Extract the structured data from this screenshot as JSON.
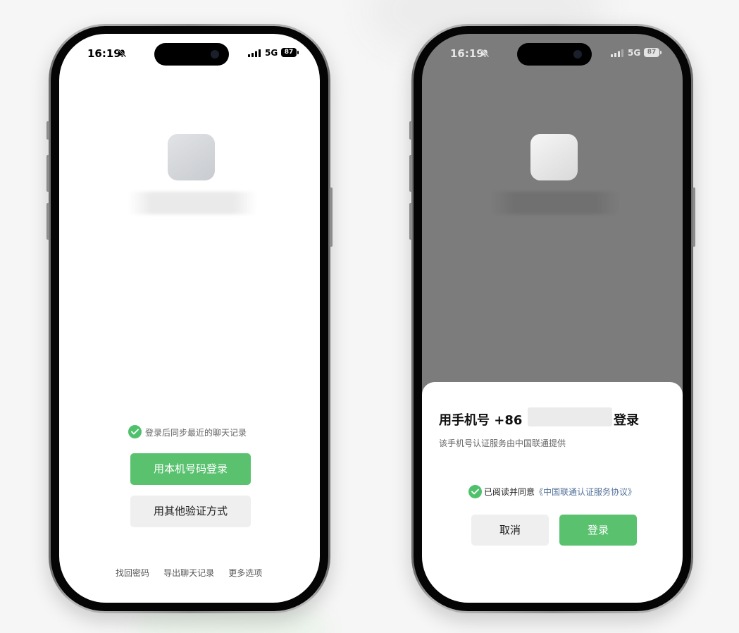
{
  "left_phone": {
    "status": {
      "time": "16:19",
      "network": "5G",
      "battery": "87"
    },
    "sync_label": "登录后同步最近的聊天记录",
    "primary_button": "用本机号码登录",
    "secondary_button": "用其他验证方式",
    "links": [
      "找回密码",
      "导出聊天记录",
      "更多选项"
    ]
  },
  "right_phone": {
    "status": {
      "time": "16:19",
      "network": "5G",
      "battery": "87"
    },
    "sheet": {
      "title_prefix": "用手机号 +86",
      "title_suffix": "登录",
      "subtitle": "该手机号认证服务由中国联通提供",
      "agree_text": "已阅读并同意",
      "agreement_link": "《中国联通认证服务协议》",
      "cancel_button": "取消",
      "login_button": "登录"
    }
  },
  "colors": {
    "accent_green": "#5ac26f",
    "check_green": "#4fc16c",
    "link_blue": "#557299",
    "dim_overlay": "#7c7c7c"
  },
  "icons": [
    "mute-bell-icon",
    "signal-icon",
    "battery-icon",
    "check-circle-icon"
  ]
}
